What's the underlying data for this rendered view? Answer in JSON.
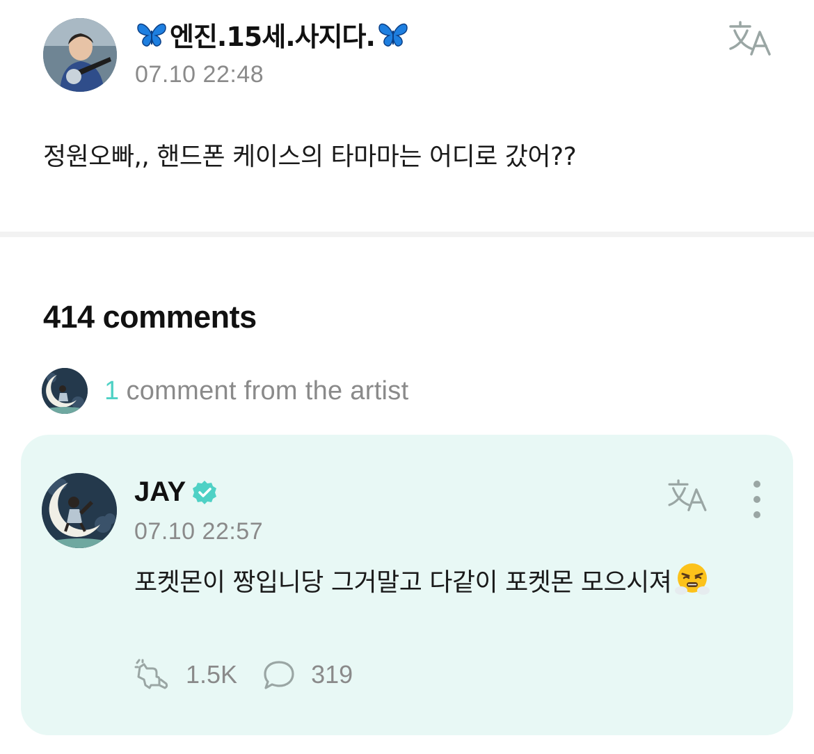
{
  "post": {
    "author": "🦋엔진.15세.사지다.🦋",
    "author_name": "엔진.15세.사지다.",
    "timestamp": "07.10 22:48",
    "body": "정원오빠,, 핸드폰 케이스의 타마마는 어디로 갔어??",
    "translate_icon": "translate-icon",
    "decor_icon": "blue-butterfly"
  },
  "comments": {
    "count_label": "414 comments",
    "artist_count": "1",
    "artist_label": "comment from the artist"
  },
  "artist_comment": {
    "author": "JAY",
    "verified_icon": "verified-badge",
    "timestamp": "07.10 22:57",
    "body": "포켓몬이 짱입니당 그거말고 다같이 포켓몬 모으시져",
    "emoji": "face-with-steam-from-nose",
    "likes": "1.5K",
    "replies": "319",
    "like_icon": "sparkle-like-icon",
    "reply_icon": "speech-bubble-icon",
    "more_icon": "vertical-ellipsis-icon"
  },
  "colors": {
    "accent": "#4fd1c5",
    "card_background": "#e8f8f5",
    "secondary_text": "#8a8a8a",
    "butterfly": "#1e7fe0"
  }
}
